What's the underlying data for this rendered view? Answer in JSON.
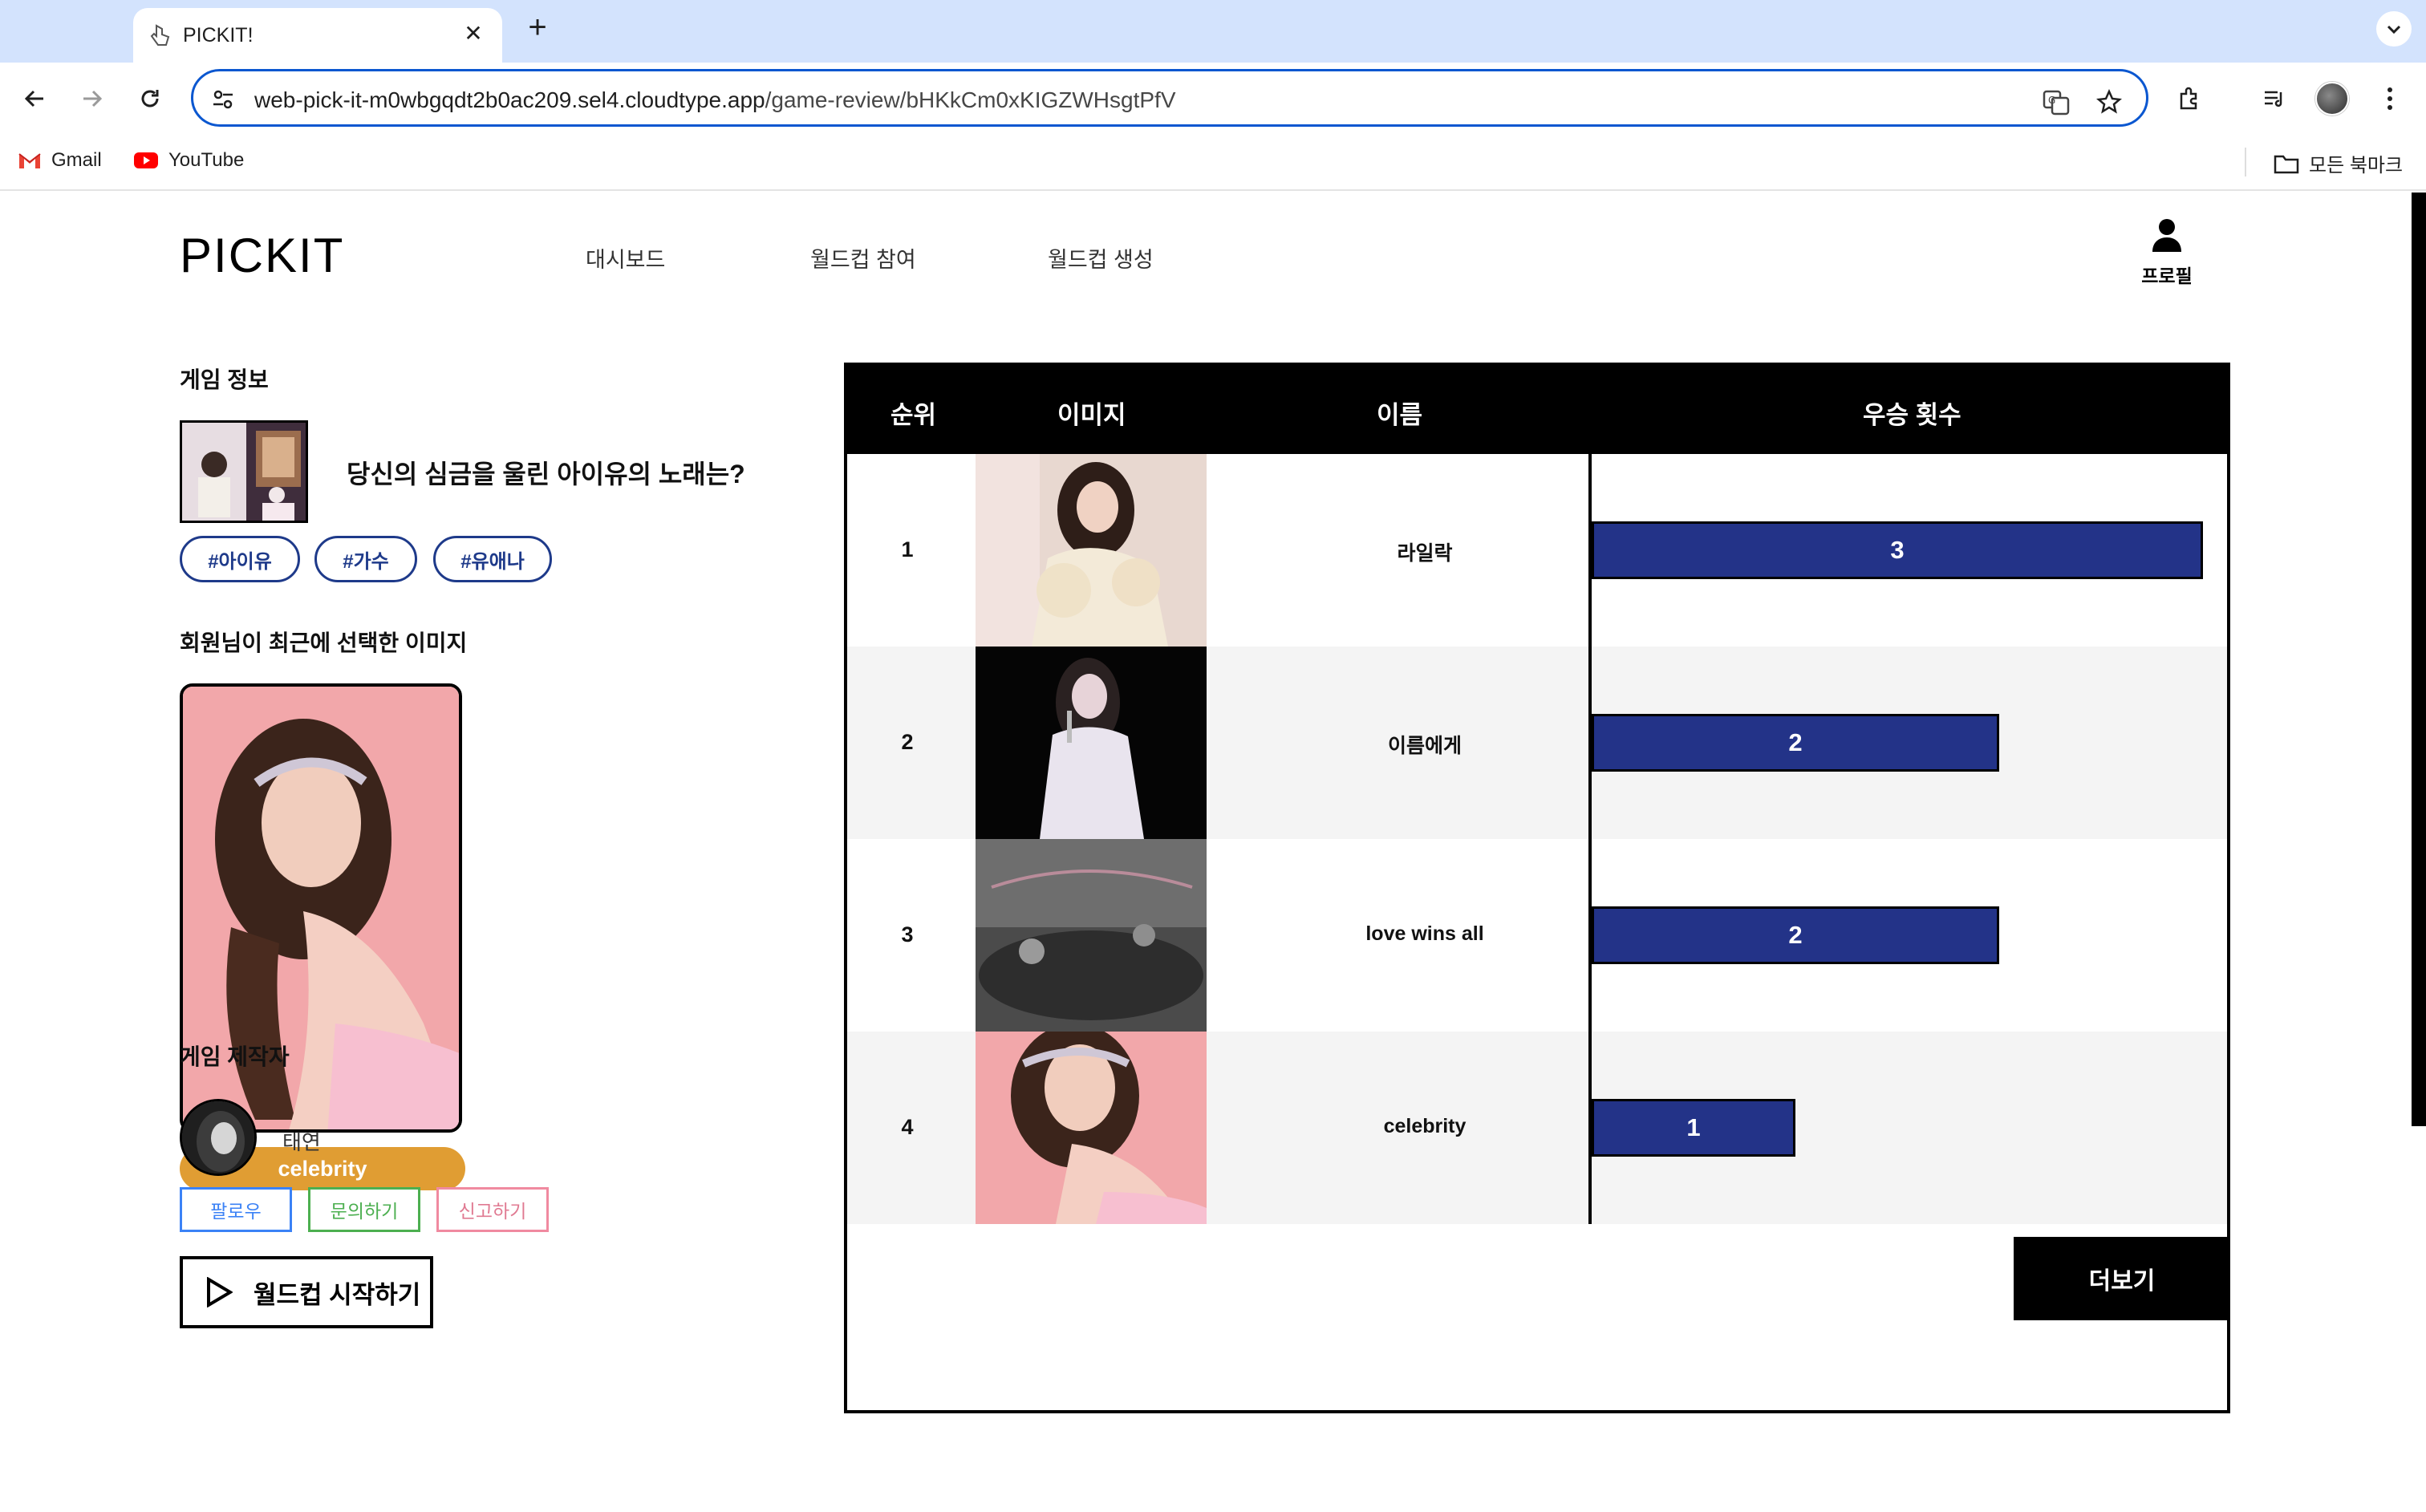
{
  "browser": {
    "tab_title": "PICKIT!",
    "url_host": "web-pick-it-m0wbgqdt2b0ac209.sel4.cloudtype.app",
    "url_path": "/game-review/bHKkCm0xKIGZWHsgtPfV",
    "bookmarks": [
      {
        "label": "Gmail",
        "icon": "gmail-icon"
      },
      {
        "label": "YouTube",
        "icon": "youtube-icon"
      }
    ],
    "all_bookmarks_label": "모든 북마크"
  },
  "header": {
    "logo": "PICKIT",
    "nav": [
      "대시보드",
      "월드컵 참여",
      "월드컵 생성"
    ],
    "profile_label": "프로필"
  },
  "game_info": {
    "section_title": "게임 정보",
    "title": "당신의 심금을 울린 아이유의 노래는?",
    "tags": [
      "#아이유",
      "#가수",
      "#유애나"
    ]
  },
  "recent": {
    "section_title": "회원님이 최근에 선택한 이미지",
    "category": "celebrity"
  },
  "creator": {
    "section_title": "게임 제작자",
    "name": "태연",
    "follow_label": "팔로우",
    "inquiry_label": "문의하기",
    "report_label": "신고하기"
  },
  "start_button_label": "월드컵 시작하기",
  "ranking": {
    "headers": {
      "rank": "순위",
      "image": "이미지",
      "name": "이름",
      "wins": "우승 횟수"
    },
    "rows": [
      {
        "rank": "1",
        "name": "라일락",
        "wins": 3
      },
      {
        "rank": "2",
        "name": "이름에게",
        "wins": 2
      },
      {
        "rank": "3",
        "name": "love wins all",
        "wins": 2
      },
      {
        "rank": "4",
        "name": "celebrity",
        "wins": 1
      }
    ],
    "max_wins": 3
  },
  "more_button_label": "더보기",
  "colors": {
    "accent_blue": "#233388",
    "category_orange": "#e09d33",
    "follow_blue": "#3b82f6",
    "inquiry_green": "#4caf50",
    "report_pink": "#f08aa0"
  }
}
